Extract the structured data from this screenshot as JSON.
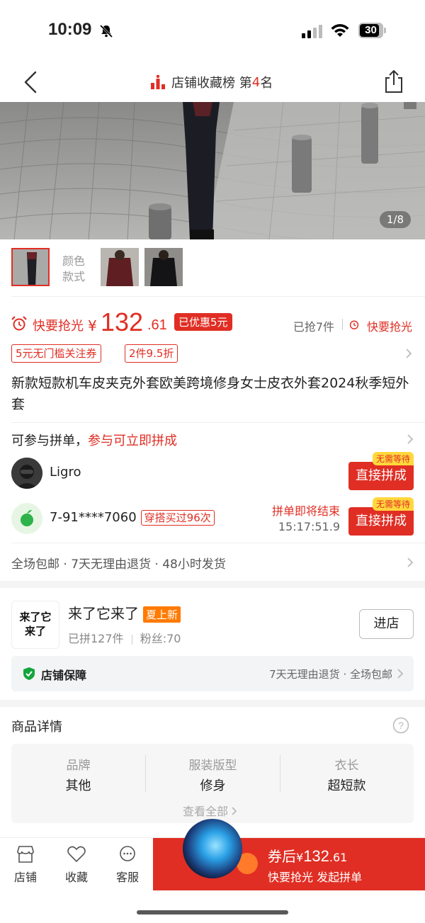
{
  "status_bar": {
    "time": "10:09",
    "battery": "30"
  },
  "nav": {
    "rank_prefix": "店铺收藏榜 第",
    "rank_num": "4",
    "rank_suffix": "名"
  },
  "hero": {
    "counter": "1/8"
  },
  "variants": {
    "label_line1": "颜色",
    "label_line2": "款式"
  },
  "price": {
    "flash_label": "快要抢光",
    "currency": "¥",
    "integer": "132",
    "decimal": ".61",
    "discount_badge": "已优惠5元",
    "sold": "已抢7件",
    "flash_label_2": "快要抢光"
  },
  "coupons": [
    "5元无门槛关注券",
    "2件9.5折"
  ],
  "product_title": "新款短款机车皮夹克外套欧美跨境修身女士皮衣外套2024秋季短外套",
  "group": {
    "heading": "可参与拼单，",
    "heading_highlight": "参与可立即拼成",
    "rows": [
      {
        "name": "Ligro",
        "badge": "",
        "button": "直接拼成",
        "no_wait": "无需等待"
      },
      {
        "name": "7-91****7060",
        "badge": "穿搭买过96次",
        "ending_label": "拼单即将结束",
        "countdown": "15:17:51.9",
        "button": "直接拼成",
        "no_wait": "无需等待"
      }
    ]
  },
  "services": "全场包邮 · 7天无理由退货 · 48小时发货",
  "store": {
    "logo_text": "来了它来了",
    "name": "来了它来了",
    "tag": "夏上新",
    "sold": "已拼127件",
    "fans": "粉丝:70",
    "enter": "进店",
    "guarantee_label": "店铺保障",
    "guarantee_detail": "7天无理由退货 · 全场包邮"
  },
  "details": {
    "heading": "商品详情",
    "specs": [
      {
        "key": "品牌",
        "value": "其他"
      },
      {
        "key": "服装版型",
        "value": "修身"
      },
      {
        "key": "衣长",
        "value": "超短款"
      }
    ],
    "see_all": "查看全部"
  },
  "bottom": {
    "tabs": [
      "店铺",
      "收藏",
      "客服"
    ],
    "cta_prefix": "券后",
    "cta_currency": "¥",
    "cta_integer": "132",
    "cta_decimal": ".61",
    "cta_line2": "快要抢光 发起拼单"
  },
  "colors": {
    "accent": "#e02e24",
    "orange_tag": "#ff7a00",
    "no_wait_bg": "#ffd83d"
  }
}
